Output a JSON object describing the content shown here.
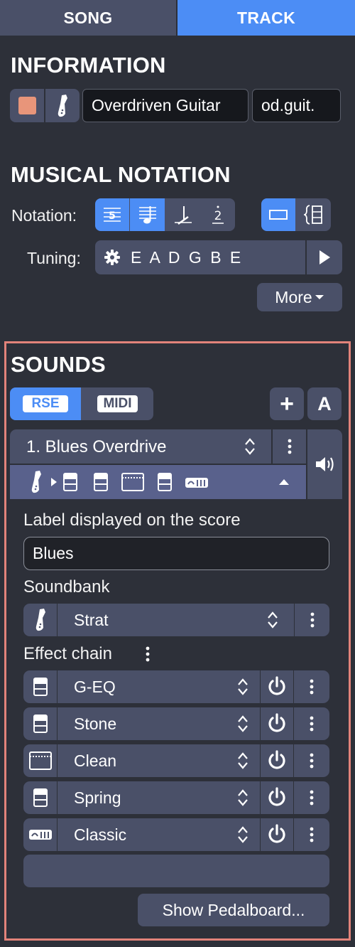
{
  "tabs": {
    "song": "SONG",
    "track": "TRACK"
  },
  "information": {
    "title": "INFORMATION",
    "color": "#e8957a",
    "track_name": "Overdriven Guitar",
    "short_name": "od.guit."
  },
  "notation": {
    "title": "MUSICAL NOTATION",
    "label": "Notation:",
    "tuning_label": "Tuning:",
    "tuning_value": "E A D G B E",
    "more_label": "More"
  },
  "sounds": {
    "title": "SOUNDS",
    "rse_label": "RSE",
    "midi_label": "MIDI",
    "add_label": "+",
    "auto_label": "A",
    "preset_name": "1. Blues Overdrive",
    "label_heading": "Label displayed on the score",
    "label_value": "Blues",
    "soundbank_heading": "Soundbank",
    "soundbank_value": "Strat",
    "effect_chain_heading": "Effect chain",
    "effects": [
      {
        "name": "G-EQ",
        "icon": "stomp-icon"
      },
      {
        "name": "Stone",
        "icon": "stomp-icon"
      },
      {
        "name": "Clean",
        "icon": "amp-icon"
      },
      {
        "name": "Spring",
        "icon": "stomp-icon"
      },
      {
        "name": "Classic",
        "icon": "mixer-icon"
      }
    ],
    "pedalboard_label": "Show Pedalboard..."
  },
  "colors": {
    "accent": "#4c8df5",
    "highlight_border": "#e2837a",
    "panel": "#2d3039",
    "control": "#4a5068"
  }
}
